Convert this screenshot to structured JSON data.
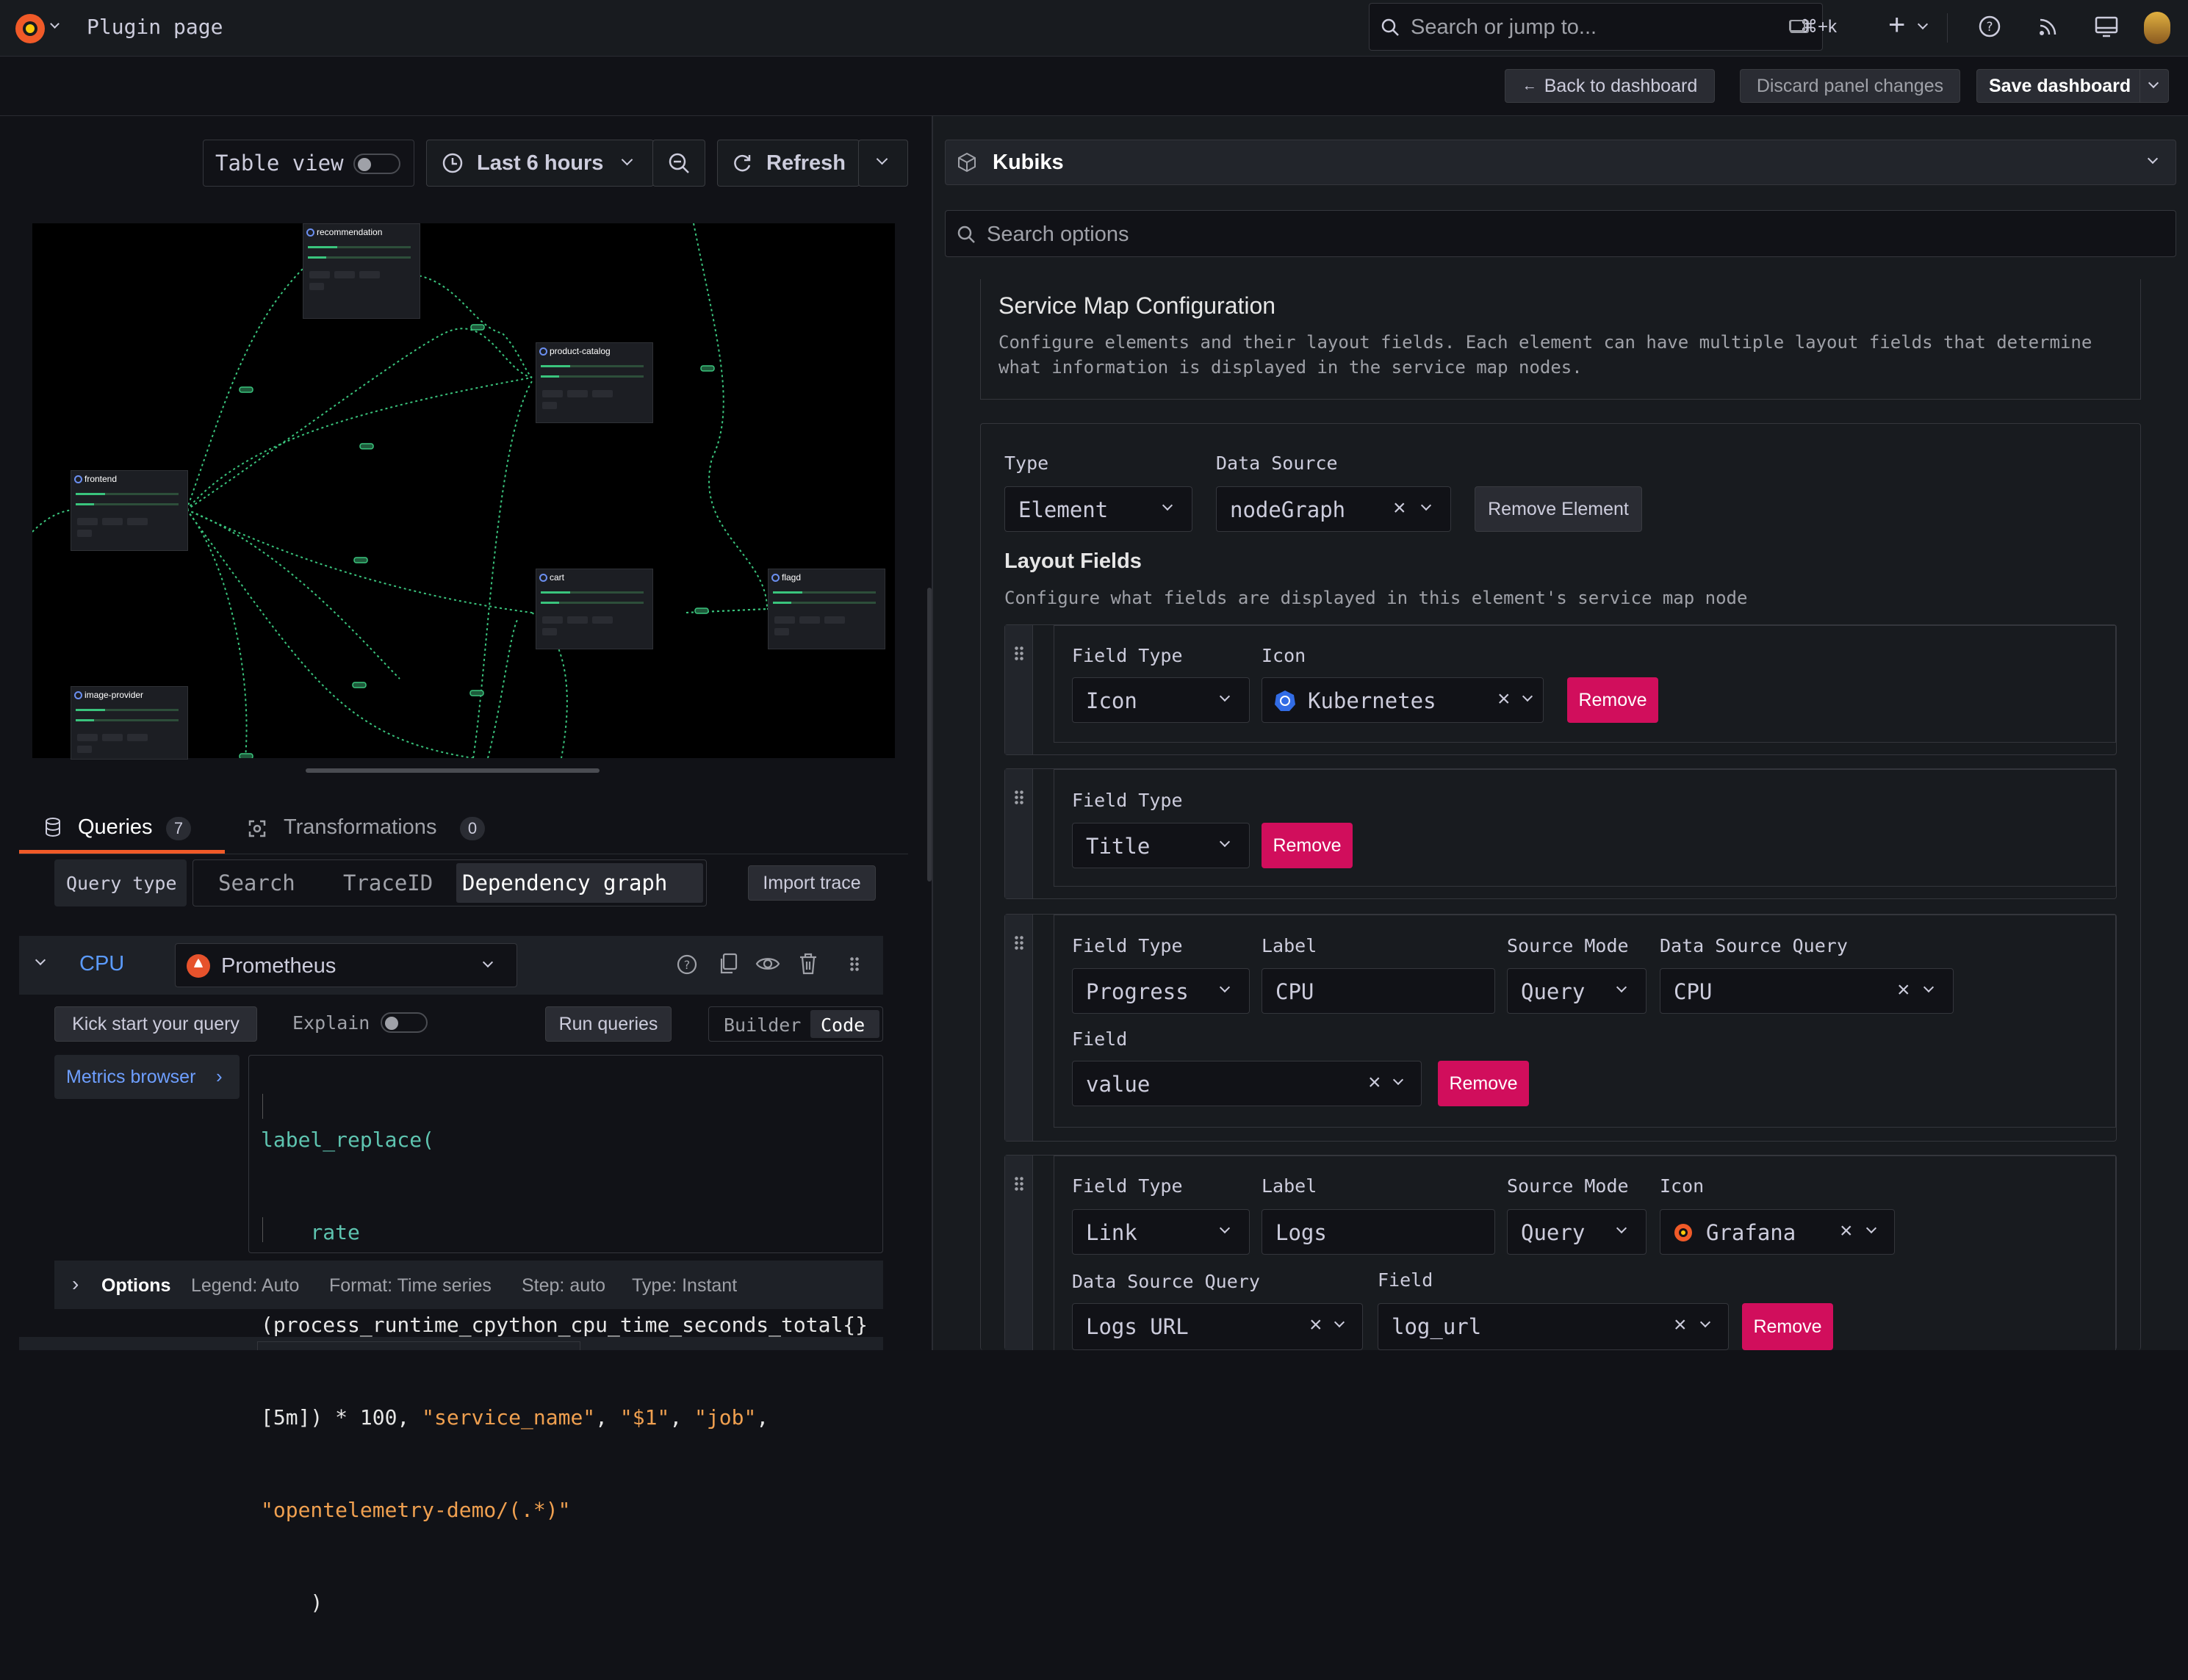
{
  "topbar": {
    "page_title": "Plugin page",
    "search_placeholder": "Search or jump to...",
    "shortcut": "⌘+k"
  },
  "toolbar": {
    "back": "Back to dashboard",
    "discard": "Discard panel changes",
    "save": "Save dashboard"
  },
  "left": {
    "table_view": "Table view",
    "time_range": "Last 6 hours",
    "refresh": "Refresh",
    "graph_nodes": [
      {
        "name": "recommendation"
      },
      {
        "name": "product-catalog"
      },
      {
        "name": "frontend"
      },
      {
        "name": "cart"
      },
      {
        "name": "flagd"
      },
      {
        "name": "image-provider"
      }
    ],
    "tabs": {
      "queries": "Queries",
      "queries_count": "7",
      "transformations": "Transformations",
      "transformations_count": "0"
    },
    "query_type_label": "Query type",
    "query_types": [
      "Search",
      "TraceID",
      "Dependency graph"
    ],
    "import_trace": "Import trace",
    "query": {
      "name": "CPU",
      "datasource": "Prometheus",
      "kick_start": "Kick start your query",
      "explain": "Explain",
      "run": "Run queries",
      "builder": "Builder",
      "code": "Code",
      "metrics_browser": "Metrics browser",
      "code_lines": {
        "l1": "label_replace(",
        "l2": "rate",
        "l3": "(process_runtime_cpython_cpu_time_seconds_total{}",
        "l4a": "[5m]) * 100, ",
        "l4b": "\"service_name\"",
        "l4c": ", ",
        "l4d": "\"$1\"",
        "l4e": ", ",
        "l4f": "\"job\"",
        "l4g": ",",
        "l5": "\"opentelemetry-demo/(.*)\"",
        "l6": ")"
      },
      "options": {
        "label": "Options",
        "legend": "Legend: Auto",
        "format": "Format: Time series",
        "step": "Step: auto",
        "type": "Type: Instant"
      }
    }
  },
  "right": {
    "viz": "Kubiks",
    "search_placeholder": "Search options",
    "config": {
      "title": "Service Map Configuration",
      "desc1": "Configure elements and their layout fields. Each element can have multiple layout fields that determine",
      "desc2": "what information is displayed in the service map nodes."
    },
    "element": {
      "type_label": "Type",
      "type_value": "Element",
      "ds_label": "Data Source",
      "ds_value": "nodeGraph",
      "remove_element": "Remove Element",
      "layout_title": "Layout Fields",
      "layout_desc": "Configure what fields are displayed in this element's service map node"
    },
    "fields": {
      "f1": {
        "field_type_label": "Field Type",
        "field_type": "Icon",
        "icon_label": "Icon",
        "icon": "Kubernetes",
        "remove": "Remove"
      },
      "f2": {
        "field_type_label": "Field Type",
        "field_type": "Title",
        "remove": "Remove"
      },
      "f3": {
        "field_type_label": "Field Type",
        "field_type": "Progress",
        "label_label": "Label",
        "label": "CPU",
        "source_mode_label": "Source Mode",
        "source_mode": "Query",
        "dsq_label": "Data Source Query",
        "dsq": "CPU",
        "field_label": "Field",
        "field": "value",
        "remove": "Remove"
      },
      "f4": {
        "field_type_label": "Field Type",
        "field_type": "Link",
        "label_label": "Label",
        "label": "Logs",
        "source_mode_label": "Source Mode",
        "source_mode": "Query",
        "icon_label": "Icon",
        "icon": "Grafana",
        "dsq_label": "Data Source Query",
        "dsq": "Logs URL",
        "field_label": "Field",
        "field": "log_url",
        "remove": "Remove"
      }
    }
  },
  "colors": {
    "accent_pink": "#d10e5c",
    "edge_green": "#3ac47d",
    "link_blue": "#6e9fff",
    "query_blue": "#5b9bff"
  }
}
